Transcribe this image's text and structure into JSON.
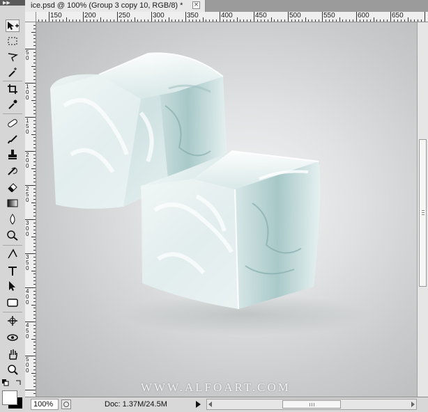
{
  "document": {
    "tab_title": "ice.psd @ 100% (Group 3 copy 10, RGB/8) *",
    "close_glyph": "×"
  },
  "ruler": {
    "horizontal_labels": [
      "150",
      "200",
      "250",
      "300",
      "350",
      "400",
      "450",
      "500",
      "550",
      "600",
      "650"
    ],
    "vertical_labels": [
      "50",
      "100",
      "150",
      "200",
      "250",
      "300",
      "350",
      "400",
      "450",
      "500"
    ]
  },
  "canvas": {
    "watermark": "WWW.ALFOART.COM",
    "background_center_color": "#f4f4f4",
    "background_edge_color": "#b7b9ba"
  },
  "status": {
    "zoom": "100%",
    "doc_info": "Doc: 1.37M/24.5M"
  },
  "tools": [
    "move-tool-icon",
    "marquee-tool-icon",
    "lasso-tool-icon",
    "magic-wand-tool-icon",
    "crop-tool-icon",
    "eyedropper-tool-icon",
    "healing-brush-tool-icon",
    "brush-tool-icon",
    "clone-stamp-tool-icon",
    "history-brush-tool-icon",
    "eraser-tool-icon",
    "gradient-tool-icon",
    "blur-tool-icon",
    "dodge-tool-icon",
    "pen-tool-icon",
    "type-tool-icon",
    "path-selection-tool-icon",
    "shape-tool-icon",
    "3d-rotate-tool-icon",
    "3d-orbit-tool-icon",
    "hand-tool-icon",
    "zoom-tool-icon"
  ],
  "colors": {
    "foreground": "#ffffff",
    "background": "#000000"
  }
}
